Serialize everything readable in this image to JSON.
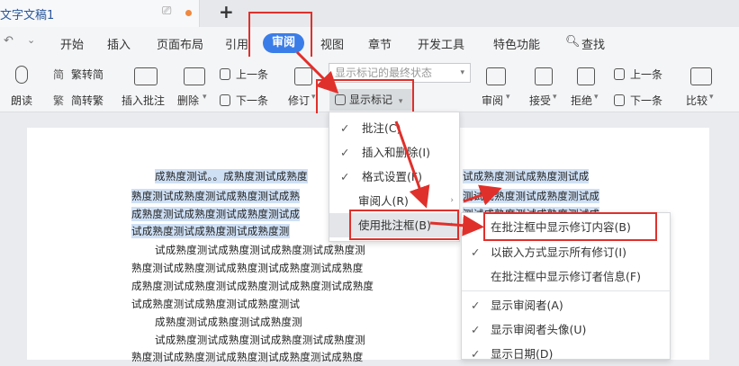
{
  "title_tab": {
    "name": "文字文稿1",
    "monitor_icon": "monitor-icon"
  },
  "menu": {
    "items": [
      "开始",
      "插入",
      "页面布局",
      "引用",
      "审阅",
      "视图",
      "章节",
      "开发工具",
      "特色功能",
      "查找"
    ],
    "active": "审阅"
  },
  "ribbon": {
    "read_aloud": "朗读",
    "trad": "繁转简",
    "simp": "简转繁",
    "insert_comment": "插入批注",
    "delete": "删除",
    "prev": "上一条",
    "next": "下一条",
    "revise": "修订",
    "display_mode_placeholder": "显示标记的最终状态",
    "show_marks": "显示标记",
    "review": "审阅",
    "accept": "接受",
    "reject": "拒绝",
    "prev2": "上一条",
    "next2": "下一条",
    "compare": "比较"
  },
  "menu1": {
    "items": [
      {
        "check": "✓",
        "label": "批注(C)",
        "arrow": ""
      },
      {
        "check": "✓",
        "label": "插入和删除(I)",
        "arrow": ""
      },
      {
        "check": "✓",
        "label": "格式设置(F)",
        "arrow": ""
      },
      {
        "check": "",
        "label": "审阅人(R)",
        "arrow": "›"
      },
      {
        "check": "",
        "label": "使用批注框(B)",
        "arrow": "›"
      }
    ]
  },
  "menu2": {
    "items": [
      {
        "check": "",
        "label": "在批注框中显示修订内容(B)"
      },
      {
        "check": "✓",
        "label": "以嵌入方式显示所有修订(I)"
      },
      {
        "check": "",
        "label": "在批注框中显示修订者信息(F)"
      },
      {
        "check": "✓",
        "label": "显示审阅者(A)"
      },
      {
        "check": "✓",
        "label": "显示审阅者头像(U)"
      },
      {
        "check": "✓",
        "label": "显示日期(D)"
      }
    ]
  },
  "document": {
    "lines": [
      "成熟度测试。。成熟度测试成熟度",
      "熟度测试成熟度测试成熟度测试成熟",
      "成熟度测试成熟度测试成熟度测试成",
      "试成熟度测试成熟度测试成熟度测",
      "试成熟度测试成熟度测试成熟度测试成熟度测",
      "熟度测试成熟度测试成熟度测试成熟度测试成熟度",
      "成熟度测试成熟度测试成熟度测试成熟度测试成熟度",
      "试成熟度测试成熟度测试成熟度测试",
      "成熟度测试成熟度测试成熟度测",
      "试成熟度测试成熟度测试成熟度测试成熟度测",
      "熟度测试成熟度测试成熟度测试成熟度测试成熟度"
    ],
    "right_lines": [
      "试成熟度测试成熟度测试成",
      "测试成熟度测试成熟度测试成",
      "测试成熟度测试成熟度测试成"
    ]
  },
  "colors": {
    "accent": "#3b7de8",
    "highlight_red": "#e0302b",
    "selection": "#cfe0f5"
  }
}
